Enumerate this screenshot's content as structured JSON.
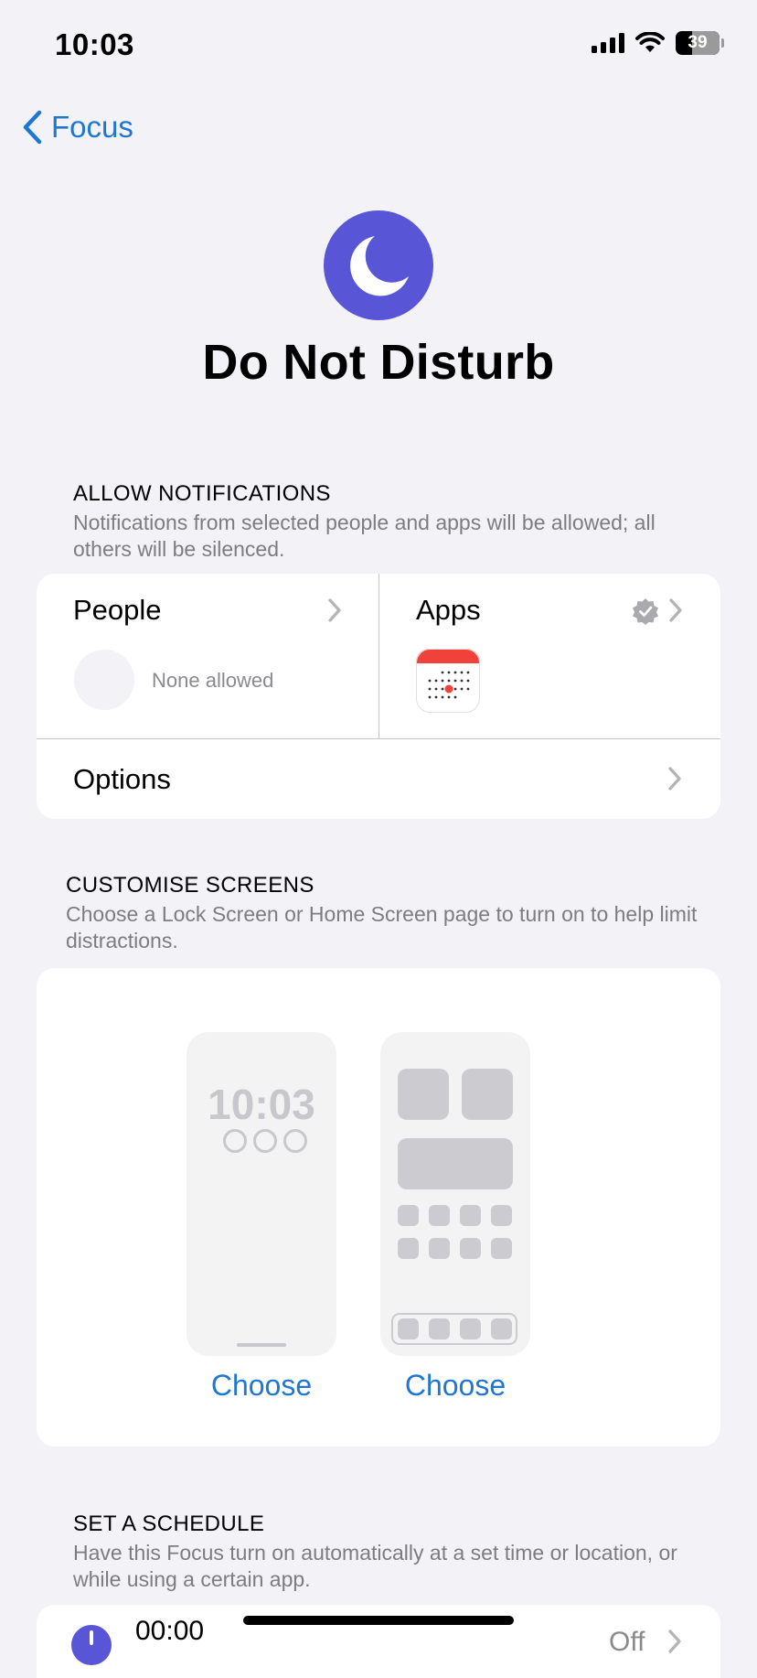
{
  "status_bar": {
    "time": "10:03",
    "battery": "39"
  },
  "nav": {
    "back_label": "Focus"
  },
  "focus": {
    "title": "Do Not Disturb",
    "icon": "moon-icon",
    "accent": "#5856D6"
  },
  "allow_notifications": {
    "header": "ALLOW NOTIFICATIONS",
    "description": "Notifications from selected people and apps will be allowed; all others will be silenced.",
    "people": {
      "label": "People",
      "status": "None allowed"
    },
    "apps": {
      "label": "Apps",
      "icon": "calendar-app-icon"
    },
    "options": {
      "label": "Options"
    }
  },
  "customise_screens": {
    "header": "CUSTOMISE SCREENS",
    "description": "Choose a Lock Screen or Home Screen page to turn on to help limit distractions.",
    "lock_time": "10:03",
    "lock_choose": "Choose",
    "home_choose": "Choose"
  },
  "schedule": {
    "header": "SET A SCHEDULE",
    "description": "Have this Focus turn on automatically at a set time or location, or while using a certain app.",
    "first_item_time": "00:00",
    "first_item_state": "Off"
  },
  "colors": {
    "link": "#1F77D4",
    "background": "#F2F2F7"
  }
}
